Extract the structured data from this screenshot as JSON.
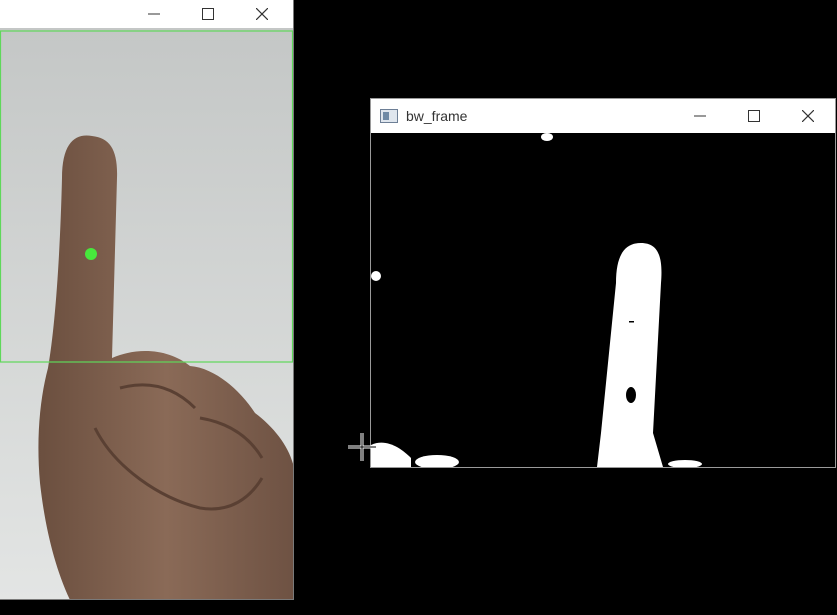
{
  "camera_window": {
    "controls": {
      "minimize_icon": "minimize-icon",
      "maximize_icon": "maximize-icon",
      "close_icon": "close-icon"
    },
    "marker_color": "#47e83c",
    "roi_box_color": "#5fd85a"
  },
  "bw_window": {
    "title": "bw_frame",
    "controls": {
      "minimize_icon": "minimize-icon",
      "maximize_icon": "maximize-icon",
      "close_icon": "close-icon"
    }
  },
  "cursor": {
    "icon": "crosshair-icon"
  }
}
